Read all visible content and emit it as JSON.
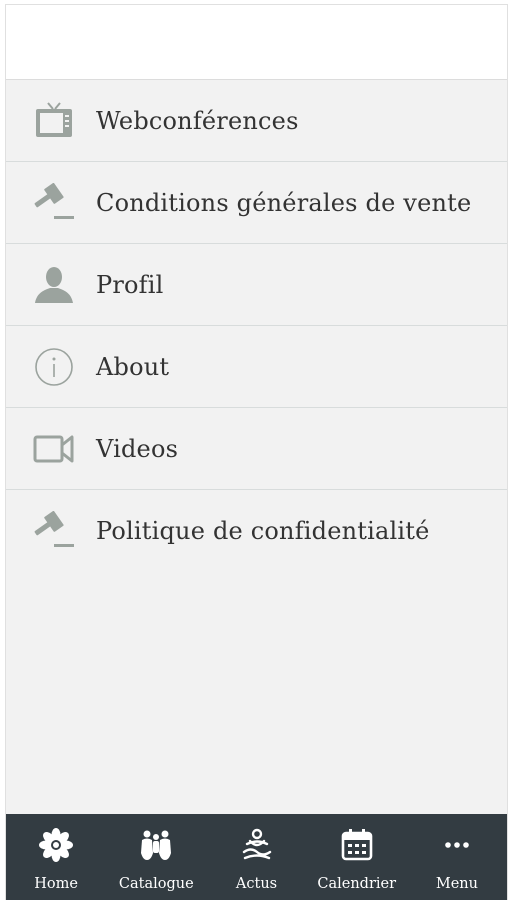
{
  "menu": {
    "items": [
      {
        "label": "Webconférences",
        "icon": "tv-icon"
      },
      {
        "label": "Conditions générales de vente",
        "icon": "gavel-icon"
      },
      {
        "label": "Profil",
        "icon": "user-icon"
      },
      {
        "label": "About",
        "icon": "info-icon"
      },
      {
        "label": "Videos",
        "icon": "video-camera-icon"
      },
      {
        "label": "Politique de confidentialité",
        "icon": "gavel-icon"
      }
    ]
  },
  "tabbar": {
    "tabs": [
      {
        "label": "Home",
        "icon": "flower-icon"
      },
      {
        "label": "Catalogue",
        "icon": "catalogue-icon"
      },
      {
        "label": "Actus",
        "icon": "meditation-icon"
      },
      {
        "label": "Calendrier",
        "icon": "calendar-icon"
      },
      {
        "label": "Menu",
        "icon": "more-dots-icon"
      }
    ]
  },
  "colors": {
    "background": "#f2f2f2",
    "tabbar": "#333c42",
    "icon_gray": "#9ba39e",
    "text": "#333333"
  }
}
